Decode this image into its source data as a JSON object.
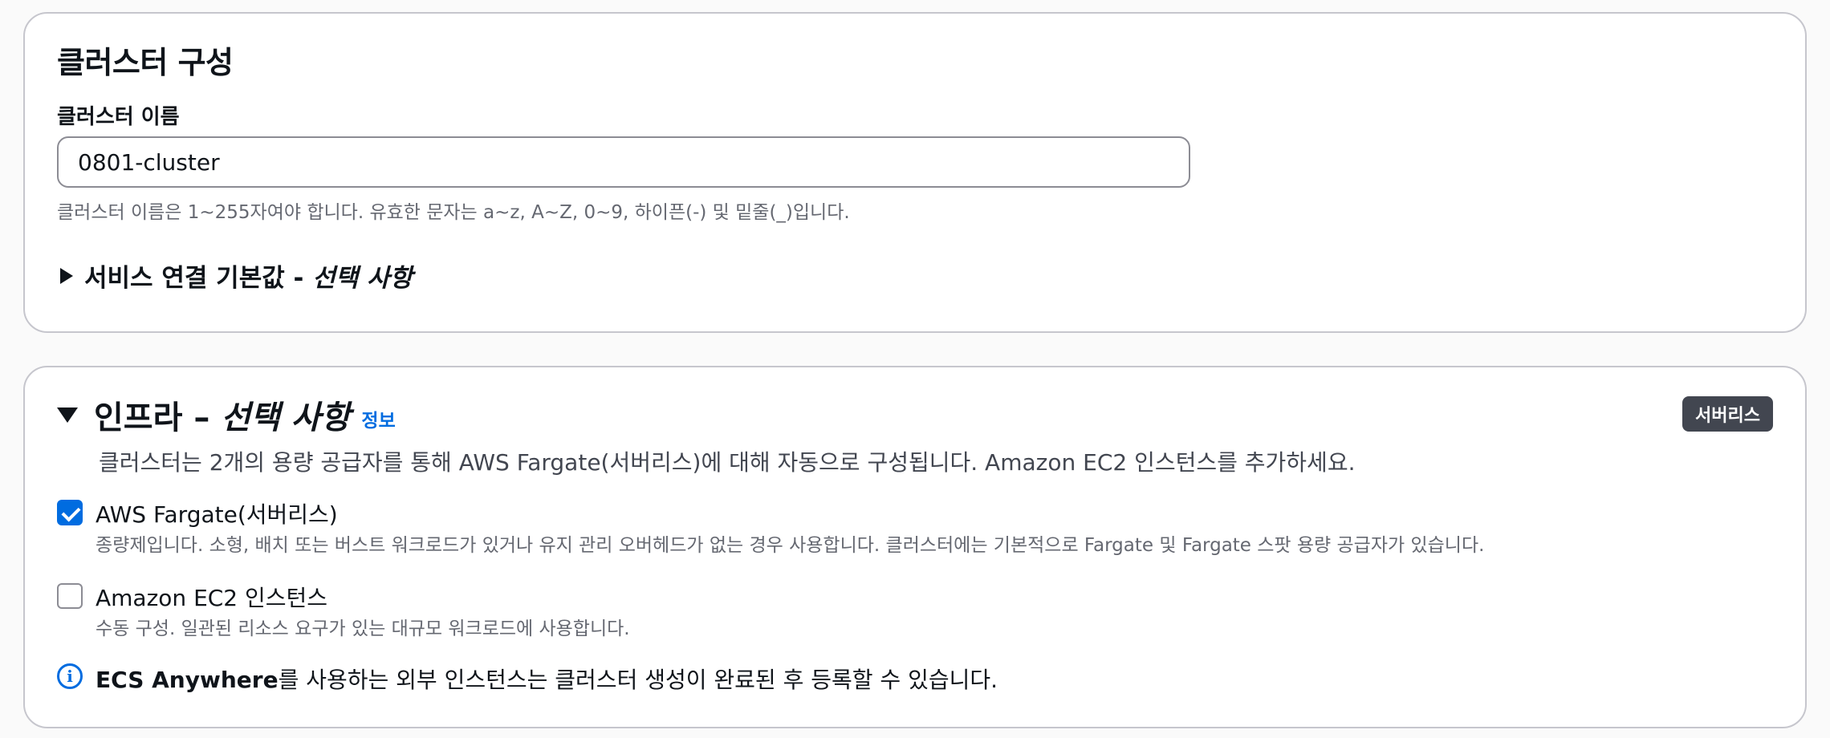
{
  "cluster_config": {
    "title": "클러스터 구성",
    "name_label": "클러스터 이름",
    "name_value": "0801-cluster",
    "name_hint": "클러스터 이름은 1~255자여야 합니다. 유효한 문자는 a~z, A~Z, 0~9, 하이픈(-) 및 밑줄(_)입니다.",
    "service_connect": {
      "label": "서비스 연결 기본값 - ",
      "optional": "선택 사항",
      "expanded": false
    }
  },
  "infrastructure": {
    "title": "인프라 – ",
    "optional": "선택 사항",
    "info_link": "정보",
    "badge": "서버리스",
    "description": "클러스터는 2개의 용량 공급자를 통해 AWS Fargate(서버리스)에 대해 자동으로 구성됩니다. Amazon EC2 인스턴스를 추가하세요.",
    "options": [
      {
        "title": "AWS Fargate(서버리스)",
        "description": "종량제입니다. 소형, 배치 또는 버스트 워크로드가 있거나 유지 관리 오버헤드가 없는 경우 사용합니다. 클러스터에는 기본적으로 Fargate 및 Fargate 스팟 용량 공급자가 있습니다.",
        "checked": true
      },
      {
        "title": "Amazon EC2 인스턴스",
        "description": "수동 구성. 일관된 리소스 요구가 있는 대규모 워크로드에 사용합니다.",
        "checked": false
      }
    ],
    "alert": {
      "bold": "ECS Anywhere",
      "text": "를 사용하는 외부 인스턴스는 클러스터 생성이 완료된 후 등록할 수 있습니다."
    }
  },
  "colors": {
    "accent": "#006ce0",
    "badge_bg": "#424650",
    "border": "#c6c6cd",
    "hint_text": "#656871"
  }
}
